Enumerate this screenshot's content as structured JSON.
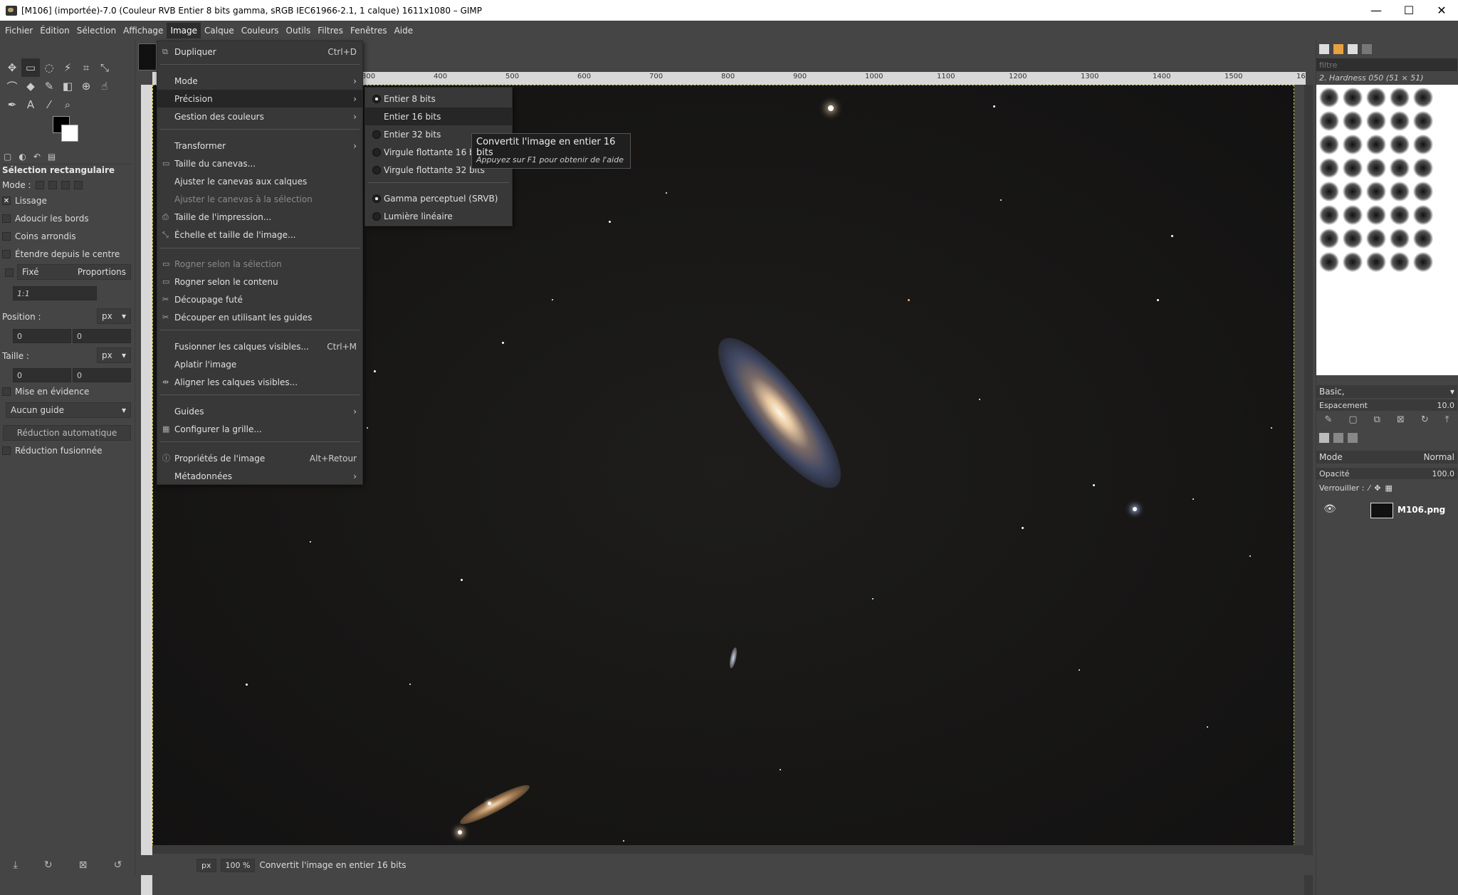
{
  "window": {
    "title": "[M106] (importée)-7.0 (Couleur RVB Entier 8 bits gamma, sRGB IEC61966-2.1, 1 calque) 1611x1080 – GIMP",
    "minimize": "—",
    "maximize": "☐",
    "close": "✕"
  },
  "menubar": [
    "Fichier",
    "Édition",
    "Sélection",
    "Affichage",
    "Image",
    "Calque",
    "Couleurs",
    "Outils",
    "Filtres",
    "Fenêtres",
    "Aide"
  ],
  "tool_options": {
    "title": "Sélection rectangulaire",
    "mode_label": "Mode :",
    "antialias": "Lissage",
    "feather": "Adoucir les bords",
    "rounded": "Coins arrondis",
    "expand_center": "Étendre depuis le centre",
    "fixed": "Fixé",
    "fixed_mode": "Proportions",
    "ratio": "1:1",
    "position_label": "Position :",
    "position_unit": "px",
    "pos_x": "0",
    "pos_y": "0",
    "size_label": "Taille :",
    "size_unit": "px",
    "size_w": "0",
    "size_h": "0",
    "highlight": "Mise en évidence",
    "guide": "Aucun guide",
    "auto_shrink": "Réduction automatique",
    "shrink_merged": "Réduction fusionnée"
  },
  "image_menu": {
    "items": [
      {
        "label": "Dupliquer",
        "accel": "Ctrl+D",
        "icon": "⧉"
      },
      {
        "label": "Mode",
        "submenu": true
      },
      {
        "label": "Précision",
        "submenu": true
      },
      {
        "label": "Gestion des couleurs",
        "submenu": true
      },
      {
        "label": "Transformer",
        "submenu": true
      },
      {
        "label": "Taille du canevas...",
        "icon": "▭"
      },
      {
        "label": "Ajuster le canevas aux calques"
      },
      {
        "label": "Ajuster le canevas à la sélection",
        "disabled": true
      },
      {
        "label": "Taille de l'impression...",
        "icon": "⎙"
      },
      {
        "label": "Échelle et taille de l'image...",
        "icon": "⤡"
      },
      {
        "label": "Rogner selon la sélection",
        "icon": "▭",
        "disabled": true
      },
      {
        "label": "Rogner selon le contenu",
        "icon": "▭"
      },
      {
        "label": "Découpage futé",
        "icon": "✂"
      },
      {
        "label": "Découper en utilisant les guides",
        "icon": "✂"
      },
      {
        "label": "Fusionner les calques visibles...",
        "accel": "Ctrl+M"
      },
      {
        "label": "Aplatir l'image"
      },
      {
        "label": "Aligner les calques visibles...",
        "icon": "⇹"
      },
      {
        "label": "Guides",
        "submenu": true
      },
      {
        "label": "Configurer la grille...",
        "icon": "▦"
      },
      {
        "label": "Propriétés de l'image",
        "accel": "Alt+Retour",
        "icon": "ⓘ"
      },
      {
        "label": "Métadonnées",
        "submenu": true
      }
    ]
  },
  "precision_menu": {
    "items": [
      "Entier 8 bits",
      "Entier 16 bits",
      "Entier 32 bits",
      "Virgule flottante 16 bits",
      "Virgule flottante 32 bits"
    ],
    "gamma_items": [
      "Gamma perceptuel (SRVB)",
      "Lumière linéaire"
    ]
  },
  "tooltip": {
    "title": "Convertit l'image en entier 16 bits",
    "help": "Appuyez sur F1 pour obtenir de l'aide"
  },
  "ruler": [
    "300",
    "400",
    "500",
    "600",
    "700",
    "800",
    "900",
    "1000",
    "1100",
    "1200",
    "1300",
    "1400",
    "1500",
    "16"
  ],
  "statusbar": {
    "unit": "px",
    "zoom": "100 %",
    "message": "Convertit l'image en entier 16 bits"
  },
  "dock": {
    "filter_placeholder": "filtre",
    "brush_name": "2. Hardness 050 (51 × 51)",
    "preset": "Basic,",
    "spacing_label": "Espacement",
    "spacing_value": "10.0",
    "layers_mode_label": "Mode",
    "layers_mode": "Normal",
    "opacity_label": "Opacité",
    "opacity_value": "100.0",
    "lock_label": "Verrouiller :",
    "layer_name": "M106.png"
  }
}
